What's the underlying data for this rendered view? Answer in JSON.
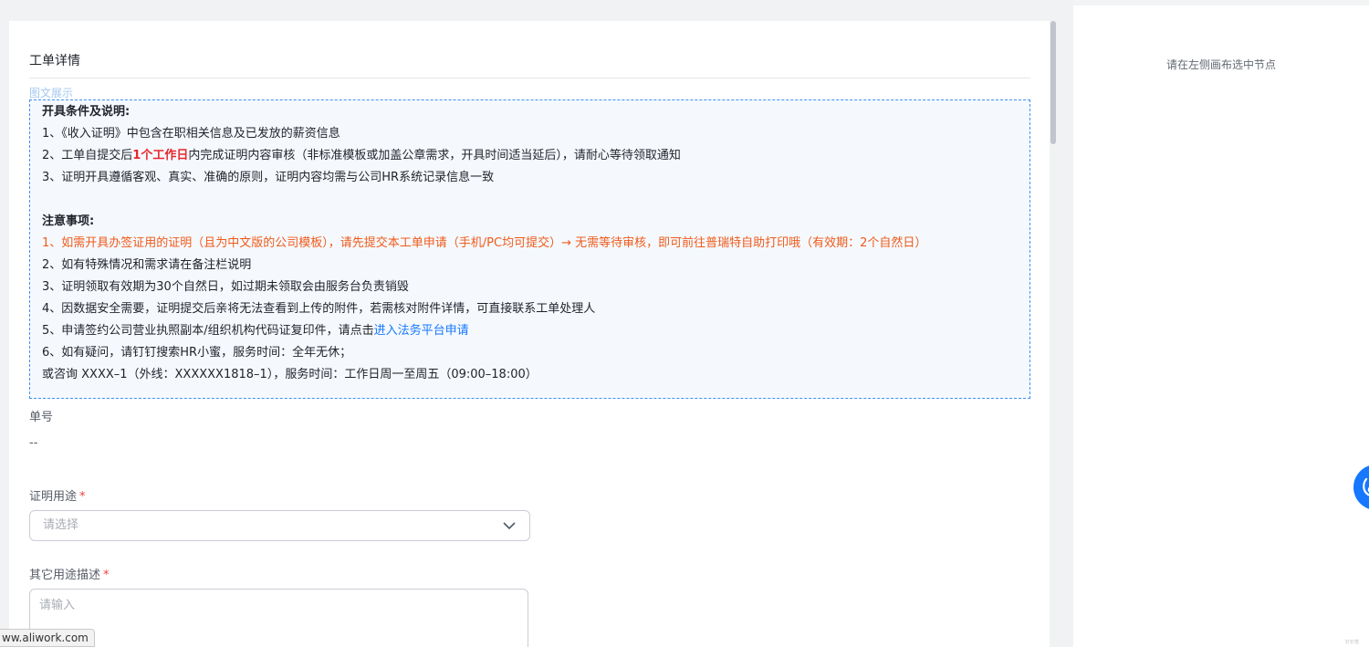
{
  "form": {
    "title": "工单详情",
    "rich_label": "图文展示",
    "rich_text": {
      "section1_title": "开具条件及说明:",
      "item1": "1、《收入证明》中包含在职相关信息及已发放的薪资信息",
      "item2_before": "2、工单自提交后",
      "item2_highlight": "1个工作日",
      "item2_after": "内完成证明内容审核（非标准模板或加盖公章需求，开具时间适当延后），请耐心等待领取通知",
      "item3": "3、证明开具遵循客观、真实、准确的原则，证明内容均需与公司HR系统记录信息一致",
      "section2_title": "注意事项:",
      "note1": "1、如需开具办签证用的证明（且为中文版的公司模板），请先提交本工单申请（手机/PC均可提交）→ 无需等待审核，即可前往普瑞特自助打印哦（有效期：2个自然日）",
      "note2": "2、如有特殊情况和需求请在备注栏说明",
      "note3": "3、证明领取有效期为30个自然日，如过期未领取会由服务台负责销毁",
      "note4": "4、因数据安全需要，证明提交后亲将无法查看到上传的附件，若需核对附件详情，可直接联系工单处理人",
      "note5_before": "5、申请签约公司营业执照副本/组织机构代码证复印件，请点击",
      "note5_link": "进入法务平台申请",
      "note6": "6、如有疑问，请钉钉搜索HR小蜜，服务时间：全年无休；",
      "note7": "或咨询 XXXX–1（外线：XXXXXX1818–1），服务时间：工作日周一至周五（09:00–18:00）"
    },
    "order_no": {
      "label": "单号",
      "value": "--"
    },
    "purpose": {
      "label": "证明用途",
      "required_mark": "*",
      "placeholder": "请选择"
    },
    "other_purpose": {
      "label": "其它用途描述",
      "required_mark": "*",
      "placeholder": "请输入"
    }
  },
  "right_panel": {
    "hint": "请在左侧画布选中节点"
  },
  "status_bar": {
    "url": "ww.aliwork.com"
  },
  "tiny_mark": "钉钉搭",
  "icons": [
    "chevron-down-icon",
    "assistant-icon"
  ],
  "colors": {
    "accent": "#1677ff",
    "required": "#f53f3f",
    "highlight_red": "#e8262c",
    "notice_orange": "#f05a1a",
    "rich_border": "#3f8ff7"
  }
}
